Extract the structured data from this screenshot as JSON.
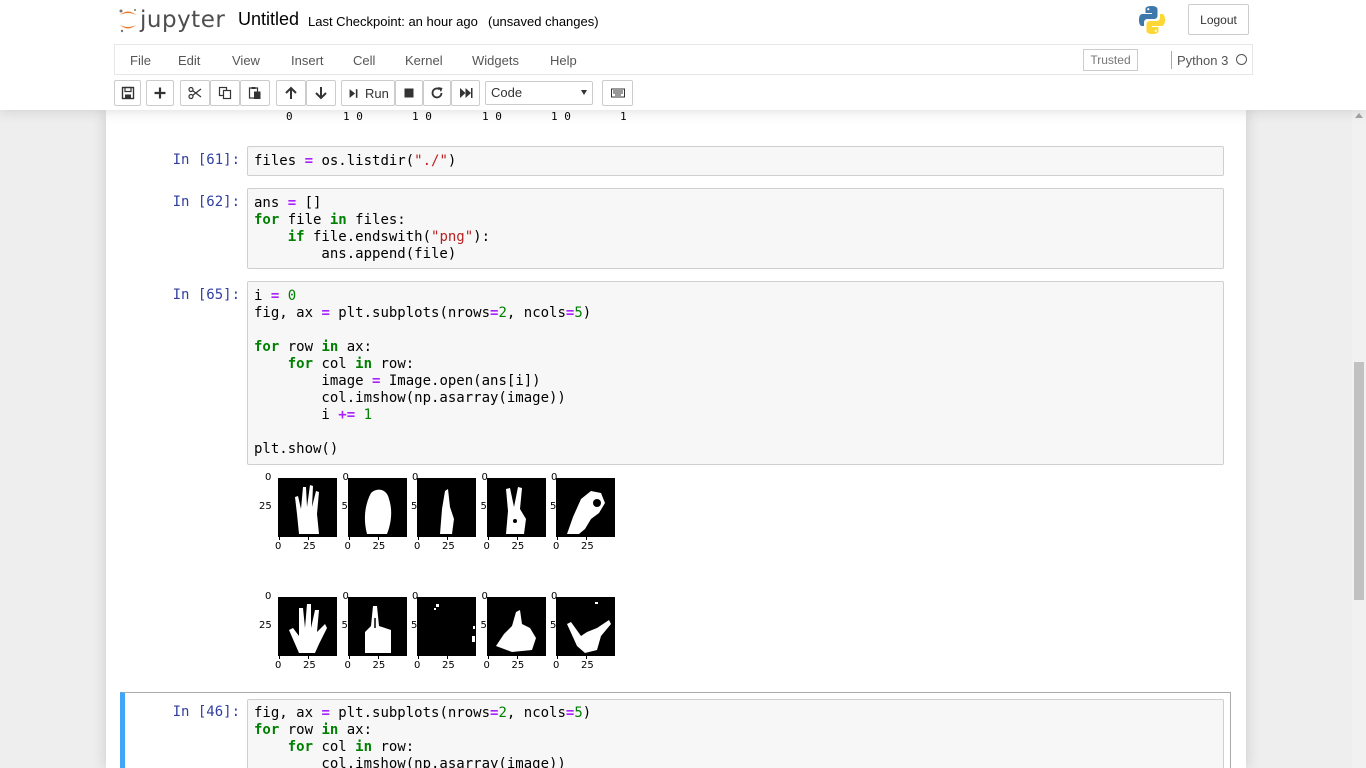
{
  "header": {
    "logo_text": "jupyter",
    "notebook_name": "Untitled",
    "checkpoint": "Last Checkpoint: an hour ago",
    "autosave_status": "(unsaved changes)",
    "logout_label": "Logout"
  },
  "menubar": {
    "items": [
      "File",
      "Edit",
      "View",
      "Insert",
      "Cell",
      "Kernel",
      "Widgets",
      "Help"
    ],
    "trusted_label": "Trusted",
    "kernel_name": "Python 3"
  },
  "toolbar": {
    "run_label": "Run",
    "cell_type": "Code"
  },
  "output_above": {
    "labels": [
      "0",
      "1 0",
      "1 0",
      "1 0",
      "1 0",
      "1"
    ]
  },
  "cells": [
    {
      "prompt": "In [61]:",
      "lines": [
        [
          [
            "files ",
            ""
          ],
          [
            "=",
            "op"
          ],
          [
            " os.listdir(",
            ""
          ],
          [
            "\"./\"",
            "str"
          ],
          [
            ")",
            ""
          ]
        ]
      ]
    },
    {
      "prompt": "In [62]:",
      "lines": [
        [
          [
            "ans ",
            ""
          ],
          [
            "=",
            "op"
          ],
          [
            " []",
            ""
          ]
        ],
        [
          [
            "for",
            "kw"
          ],
          [
            " file ",
            ""
          ],
          [
            "in",
            "kw"
          ],
          [
            " files:",
            ""
          ]
        ],
        [
          [
            "    ",
            ""
          ],
          [
            "if",
            "kw"
          ],
          [
            " file.endswith(",
            ""
          ],
          [
            "\"png\"",
            "str"
          ],
          [
            "):",
            ""
          ]
        ],
        [
          [
            "        ans.append(file)",
            ""
          ]
        ]
      ]
    },
    {
      "prompt": "In [65]:",
      "lines": [
        [
          [
            "i ",
            ""
          ],
          [
            "=",
            "op"
          ],
          [
            " ",
            ""
          ],
          [
            "0",
            "num"
          ]
        ],
        [
          [
            "fig, ax ",
            ""
          ],
          [
            "=",
            "op"
          ],
          [
            " plt.subplots(nrows",
            ""
          ],
          [
            "=",
            "op"
          ],
          [
            "2",
            "num"
          ],
          [
            ", ncols",
            ""
          ],
          [
            "=",
            "op"
          ],
          [
            "5",
            "num"
          ],
          [
            ")",
            ""
          ]
        ],
        [
          [
            "",
            ""
          ]
        ],
        [
          [
            "for",
            "kw"
          ],
          [
            " row ",
            ""
          ],
          [
            "in",
            "kw"
          ],
          [
            " ax:",
            ""
          ]
        ],
        [
          [
            "    ",
            ""
          ],
          [
            "for",
            "kw"
          ],
          [
            " col ",
            ""
          ],
          [
            "in",
            "kw"
          ],
          [
            " row:",
            ""
          ]
        ],
        [
          [
            "        image ",
            ""
          ],
          [
            "=",
            "op"
          ],
          [
            " Image.open(ans[i])",
            ""
          ]
        ],
        [
          [
            "        col.imshow(np.asarray(image))",
            ""
          ]
        ],
        [
          [
            "        i ",
            ""
          ],
          [
            "+=",
            "op"
          ],
          [
            " ",
            ""
          ],
          [
            "1",
            "num"
          ]
        ],
        [
          [
            "",
            ""
          ]
        ],
        [
          [
            "plt.show()",
            ""
          ]
        ]
      ]
    },
    {
      "prompt": "In [46]:",
      "lines": [
        [
          [
            "fig, ax ",
            ""
          ],
          [
            "=",
            "op"
          ],
          [
            " plt.subplots(nrows",
            ""
          ],
          [
            "=",
            "op"
          ],
          [
            "2",
            "num"
          ],
          [
            ", ncols",
            ""
          ],
          [
            "=",
            "op"
          ],
          [
            "5",
            "num"
          ],
          [
            ")",
            ""
          ]
        ],
        [
          [
            "for",
            "kw"
          ],
          [
            " row ",
            ""
          ],
          [
            "in",
            "kw"
          ],
          [
            " ax:",
            ""
          ]
        ],
        [
          [
            "    ",
            ""
          ],
          [
            "for",
            "kw"
          ],
          [
            " col ",
            ""
          ],
          [
            "in",
            "kw"
          ],
          [
            " row:",
            ""
          ]
        ],
        [
          [
            "        col.imshow(np.asarray(image))",
            ""
          ]
        ]
      ]
    }
  ],
  "figure": {
    "x_tick_labels": [
      "0",
      "25"
    ],
    "y_tick_labels": [
      "0",
      "25"
    ],
    "y_tick_partial": "5",
    "rows": 2,
    "cols": 5,
    "image_colors": {
      "background": "#000000",
      "foreground": "#ffffff"
    }
  },
  "colors": {
    "prompt": "#303f9f",
    "keyword": "#008000",
    "operator": "#aa22ff",
    "string": "#ba2121",
    "selected_border": "#42a5f5"
  }
}
